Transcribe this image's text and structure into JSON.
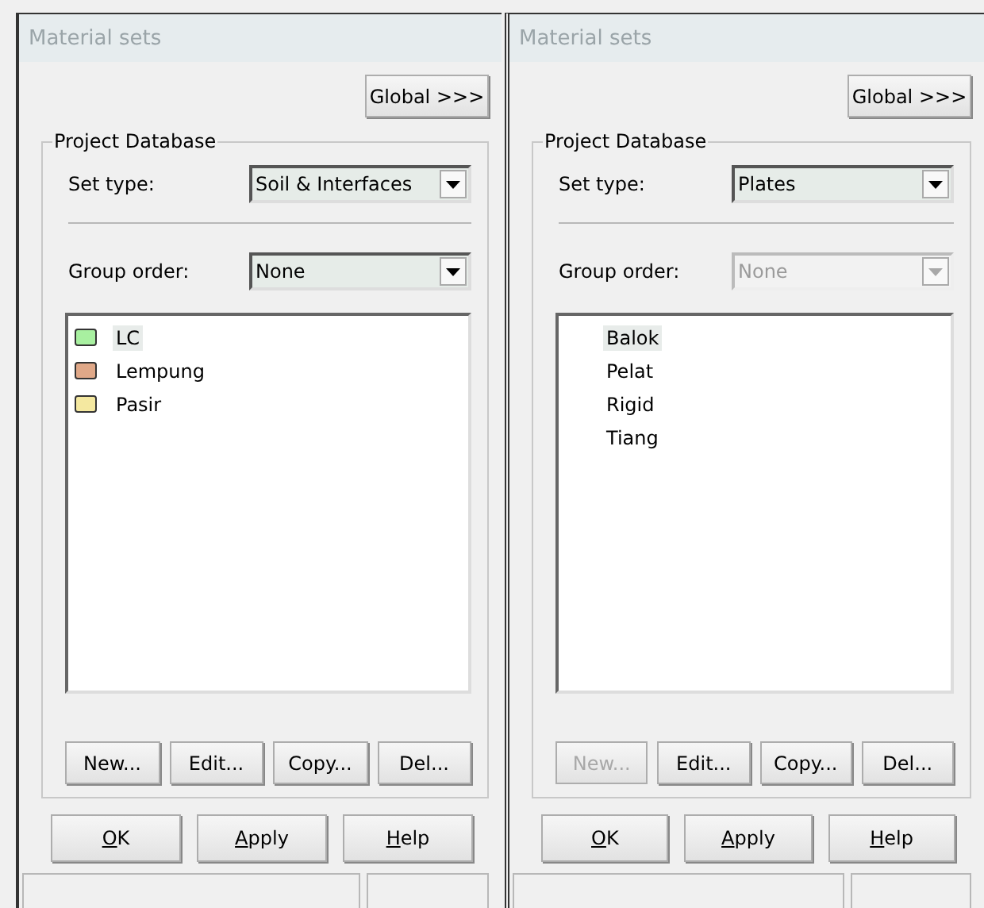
{
  "dialogs": [
    {
      "title": "Material sets",
      "global_button": "Global >>>",
      "group_title": "Project Database",
      "set_type": {
        "label": "Set type:",
        "value": "Soil & Interfaces",
        "disabled": false
      },
      "group_order": {
        "label": "Group order:",
        "value": "None",
        "disabled": false
      },
      "items": [
        {
          "label": "LC",
          "color": "#a8f0a0",
          "selected": true
        },
        {
          "label": "Lempung",
          "color": "#e0a888",
          "selected": false
        },
        {
          "label": "Pasir",
          "color": "#f4e8a0",
          "selected": false
        }
      ],
      "list_buttons": [
        {
          "label": "New...",
          "disabled": false
        },
        {
          "label": "Edit...",
          "disabled": false
        },
        {
          "label": "Copy...",
          "disabled": false
        },
        {
          "label": "Del...",
          "disabled": false
        }
      ],
      "dialog_buttons": [
        "OK",
        "Apply",
        "Help"
      ]
    },
    {
      "title": "Material sets",
      "global_button": "Global >>>",
      "group_title": "Project Database",
      "set_type": {
        "label": "Set type:",
        "value": "Plates",
        "disabled": false
      },
      "group_order": {
        "label": "Group order:",
        "value": "None",
        "disabled": true
      },
      "items": [
        {
          "label": "Balok",
          "selected": true
        },
        {
          "label": "Pelat",
          "selected": false
        },
        {
          "label": "Rigid",
          "selected": false
        },
        {
          "label": "Tiang",
          "selected": false
        }
      ],
      "list_buttons": [
        {
          "label": "New...",
          "disabled": true
        },
        {
          "label": "Edit...",
          "disabled": false
        },
        {
          "label": "Copy...",
          "disabled": false
        },
        {
          "label": "Del...",
          "disabled": false
        }
      ],
      "dialog_buttons": [
        "OK",
        "Apply",
        "Help"
      ]
    }
  ]
}
